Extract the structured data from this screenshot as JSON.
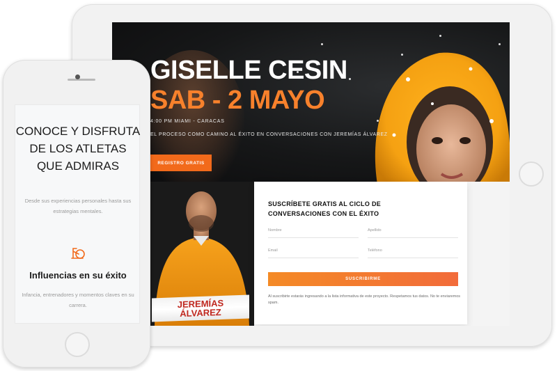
{
  "hero": {
    "title": "GISELLE CESIN",
    "date": "SAB - 2 MAYO",
    "time": "4:00 PM MIAMI - CARACAS",
    "description": "EL PROCESO COMO CAMINO AL ÉXITO EN CONVERSACIONES CON JEREMÍAS ÁLVAREZ",
    "button": "REGISTRO GRATIS"
  },
  "speaker": {
    "first_name": "JEREMÍAS",
    "last_name": "ÁLVAREZ"
  },
  "form": {
    "title": "SUSCRÍBETE GRATIS AL CICLO DE CONVERSACIONES CON EL ÉXITO",
    "fields": {
      "name": "Nombre",
      "lastname": "Apellido",
      "email": "Email",
      "phone": "Teléfono"
    },
    "button": "SUSCRIBIRME",
    "note": "Al suscribirte estarás ingresando a la lista informativa de este proyecto. Respetamos tus datos. No te enviaremos spam."
  },
  "phone": {
    "heading": "CONOCE Y DISFRUTA DE LOS ATLETAS QUE ADMIRAS",
    "subtext": "Desde sus experiencias personales hasta sus estrategias mentales.",
    "icon": "exercise-bike-icon",
    "feature_title": "Influencias en su éxito",
    "feature_desc": "Infancia, entrenadores y momentos claves en su carrera."
  },
  "colors": {
    "accent": "#f26a1b",
    "dark": "#161718",
    "red": "#c0281f"
  }
}
